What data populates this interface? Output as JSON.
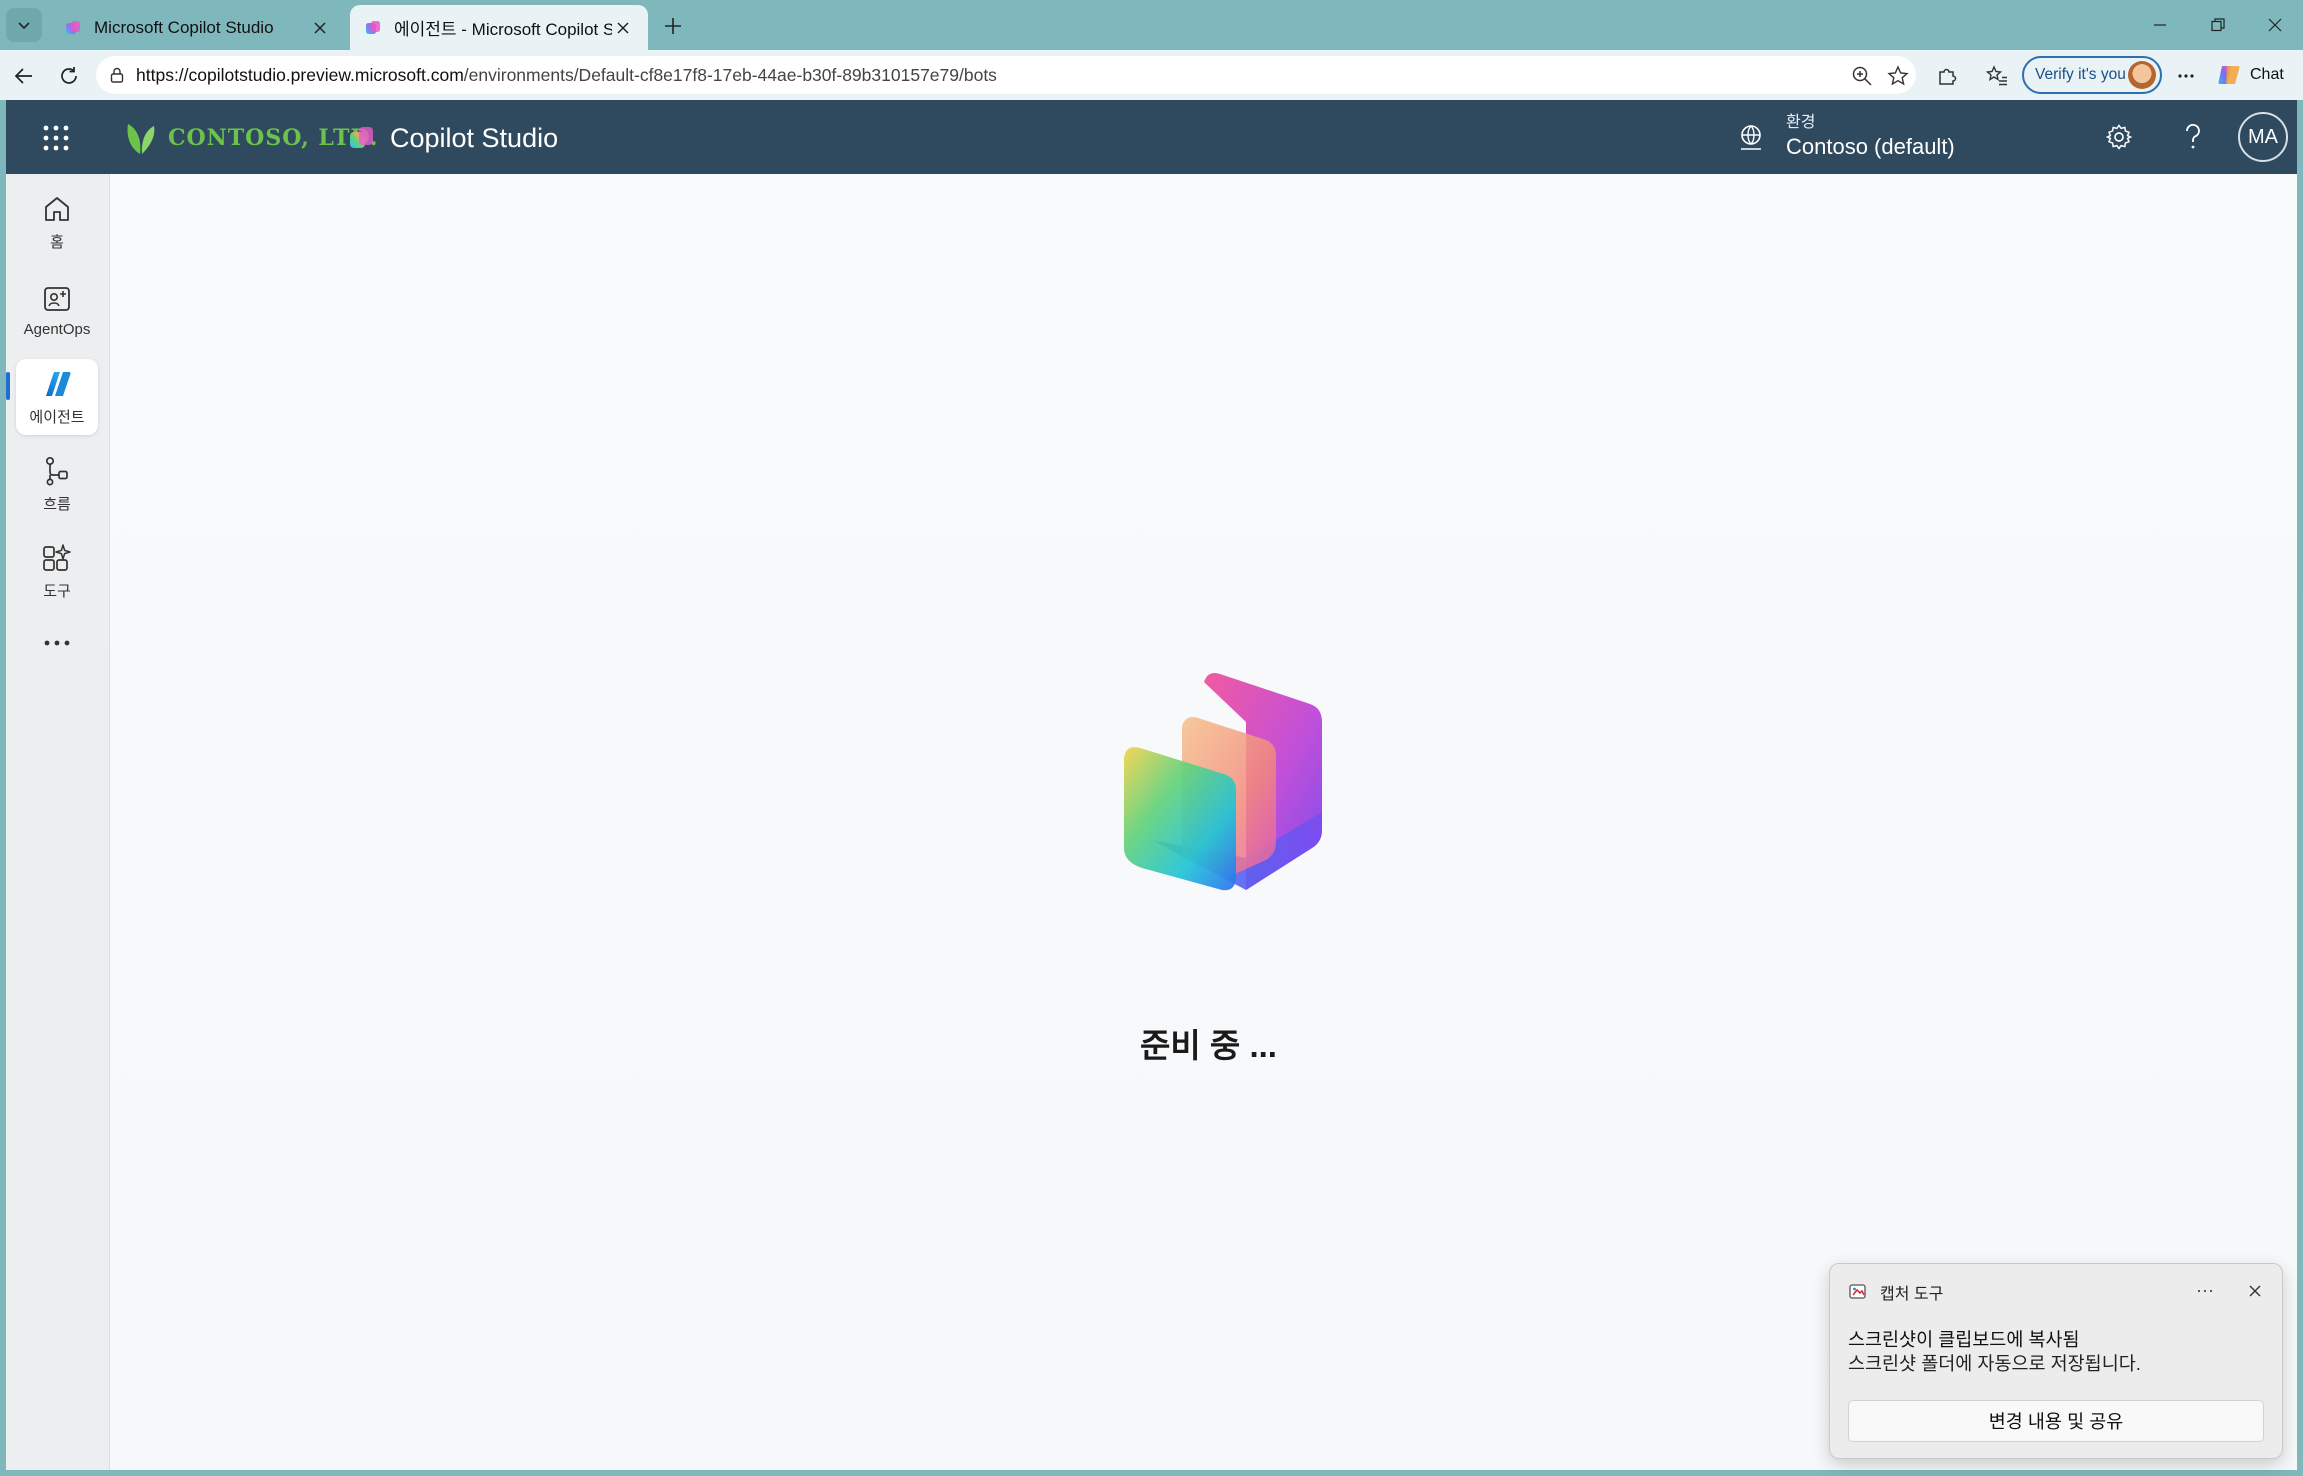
{
  "browser": {
    "tabs": [
      {
        "title": "Microsoft Copilot Studio",
        "active": false
      },
      {
        "title": "에이전트 - Microsoft Copilot Studio",
        "active": true
      }
    ],
    "url_host": "https://copilotstudio.preview.microsoft.com",
    "url_path": "/environments/Default-cf8e17f8-17eb-44ae-b30f-89b310157e79/bots",
    "verify_label": "Verify it's you",
    "chat_label": "Chat"
  },
  "header": {
    "org_name": "CONTOSO, LTD.",
    "product_name": "Copilot Studio",
    "env_label": "환경",
    "env_value": "Contoso (default)",
    "avatar_initials": "MA",
    "brand_green": "#6cc24a",
    "bar_color": "#2f4a5f"
  },
  "rail": {
    "items": [
      {
        "label": "홈",
        "icon": "home-icon"
      },
      {
        "label": "AgentOps",
        "icon": "agentops-icon"
      },
      {
        "label": "에이전트",
        "icon": "agents-icon",
        "selected": true
      },
      {
        "label": "흐름",
        "icon": "flows-icon"
      },
      {
        "label": "도구",
        "icon": "tools-icon"
      }
    ],
    "more_icon": "more-horizontal-icon"
  },
  "main": {
    "loading_text": "준비 중 ..."
  },
  "toast": {
    "app_name": "캡처 도구",
    "line1": "스크린샷이 클립보드에 복사됨",
    "line2": "스크린샷 폴더에 자동으로 저장됩니다.",
    "button_label": "변경 내용 및 공유",
    "more_label": "···"
  }
}
